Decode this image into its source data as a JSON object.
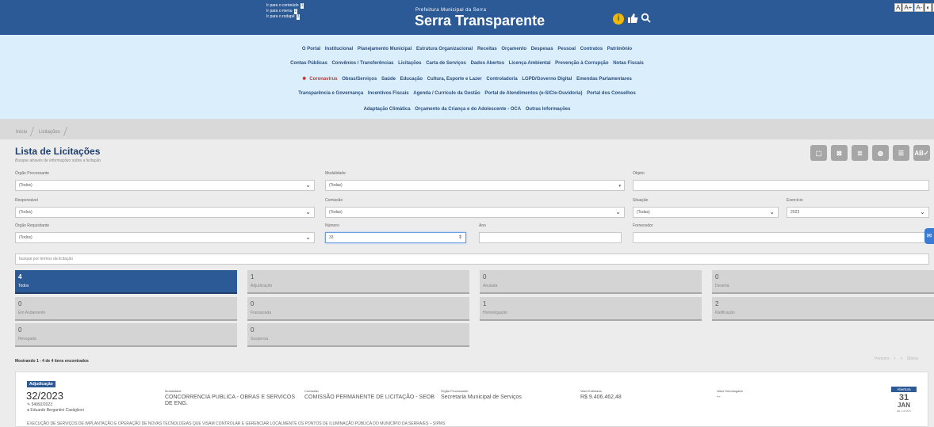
{
  "header": {
    "skip_links": [
      {
        "label": "Ir para o conteúdo",
        "key": "1"
      },
      {
        "label": "Ir para o menu",
        "key": "2"
      },
      {
        "label": "Ir para o rodapé",
        "key": "3"
      }
    ],
    "prefeitura": "Prefeitura Municipal da Serra",
    "brand": "Serra Transparente",
    "accessibility": [
      "A",
      "A+",
      "A-",
      "◐",
      "⛶"
    ]
  },
  "menu": {
    "row1": [
      "O Portal",
      "Institucional",
      "Planejamento Municipal",
      "Estrutura Organizacional",
      "Receitas",
      "Orçamento",
      "Despesas",
      "Pessoal",
      "Contratos",
      "Patrimônio"
    ],
    "row2": [
      "Contas Públicas",
      "Convênios / Transferências",
      "Licitações",
      "Carta de Serviços",
      "Dados Abertos",
      "Licença Ambiental",
      "Prevenção à Corrupção",
      "Notas Fiscais"
    ],
    "row3": [
      "Coronavírus",
      "Obras/Serviços",
      "Saúde",
      "Educação",
      "Cultura, Esporte e Lazer",
      "Controladoria",
      "LGPD/Governo Digital",
      "Emendas Parlamentares"
    ],
    "row4": [
      "Transparência e Governança",
      "Incentivos Fiscais",
      "Agenda / Currículo da Gestão",
      "Portal de Atendimentos (e-SIC/e-Ouvidoria)",
      "Portal dos Conselhos"
    ],
    "row5": [
      "Adaptação Climática",
      "Orçamento da Criança e do Adolescente - OCA",
      "Outras Informações"
    ]
  },
  "breadcrumb": [
    "Início",
    "Licitações"
  ],
  "page": {
    "title": "Lista de Licitações",
    "subtitle": "Busque através de informações sobre a licitação",
    "tools": [
      "PDF",
      "XLS",
      "DOC",
      "WEB",
      "DB",
      "AB✓"
    ]
  },
  "filters": {
    "orgao_processante": {
      "label": "Órgão Processante",
      "value": "(Todos)"
    },
    "modalidade": {
      "label": "Modalidade",
      "value": "(Todas)"
    },
    "objeto": {
      "label": "Objeto",
      "value": ""
    },
    "responsavel": {
      "label": "Responsável",
      "value": "(Todos)"
    },
    "comissao": {
      "label": "Comissão",
      "value": "(Todas)"
    },
    "situacao": {
      "label": "Situação",
      "value": "(Todas)"
    },
    "exercicio": {
      "label": "Exercício",
      "value": "2023"
    },
    "orgao_requisitante": {
      "label": "Órgão Requisitante",
      "value": "(Todos)"
    },
    "numero": {
      "label": "Número",
      "value": "33"
    },
    "ano": {
      "label": "Ano",
      "value": ""
    },
    "fornecedor": {
      "label": "Fornecedor",
      "value": ""
    },
    "search_placeholder": "busque por termos da licitação"
  },
  "status_tiles": [
    {
      "count": "4",
      "label": "Todos"
    },
    {
      "count": "1",
      "label": "Adjudicação"
    },
    {
      "count": "0",
      "label": "Anulada"
    },
    {
      "count": "0",
      "label": "Deserta"
    },
    {
      "count": "0",
      "label": "Em Andamento"
    },
    {
      "count": "0",
      "label": "Fracassada"
    },
    {
      "count": "1",
      "label": "Homologação"
    },
    {
      "count": "2",
      "label": "Ratificação"
    },
    {
      "count": "0",
      "label": "Revogada"
    },
    {
      "count": "0",
      "label": "Suspensa"
    }
  ],
  "results": {
    "showing": "Mostrando 1 - 4 de 4 itens encontrados",
    "pager": [
      "Primeira",
      "<",
      ">",
      "Última"
    ]
  },
  "card": {
    "status": "Adjudicação",
    "number": "32/2023",
    "process": "54992/2023",
    "responsible": "Eduardo Bergantini Castiglioni",
    "modalidade_label": "Modalidade",
    "modalidade": "CONCORRENCIA PUBLICA - OBRAS E SERVICOS DE ENG.",
    "comissao_label": "Comissão",
    "comissao": "COMISSÃO PERMANENTE DE LICITAÇÃO - SEOB",
    "orgao_label": "Órgão Processante",
    "orgao": "Secretaria Municipal de Serviços",
    "valor_estimado_label": "Valor Estimado",
    "valor_estimado": "R$ 9.406.462,48",
    "valor_homologado_label": "Valor Homologado",
    "valor_homologado": "--",
    "abertura_label": "Abertura",
    "day": "31",
    "month": "JAN",
    "time": "às 14:00h",
    "description": "EXECUÇÃO DE SERVIÇOS DE IMPLANTAÇÃO E OPERAÇÃO DE NOVAS TECNOLOGIAS QUE VISAM CONTROLAR E GERENCIAR LOCALMENTE OS PONTOS DE ILUMINAÇÃO PÚBLICA DO MUNICÍPIO DA SERRA/ES – SIPMS"
  },
  "colors": {
    "header": "#2c5a96",
    "menu_bg": "#dbeefb",
    "accent_yellow": "#f2b705"
  }
}
